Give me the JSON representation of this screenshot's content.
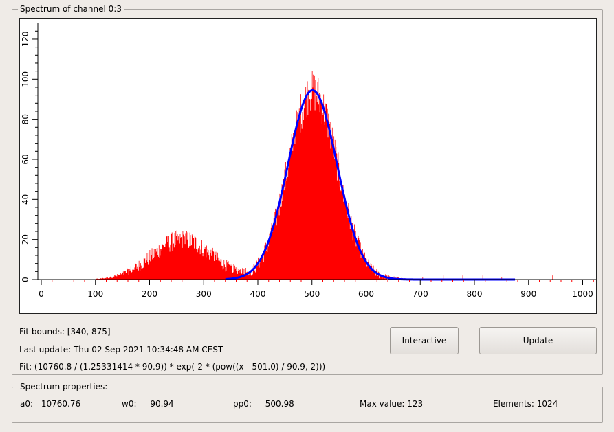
{
  "spectrum_panel": {
    "title": "Spectrum of channel 0:3",
    "fit_bounds": "Fit bounds: [340, 875]",
    "last_update": "Last update: Thu 02 Sep 2021 10:34:48 AM CEST",
    "fit_formula": "Fit: (10760.8 / (1.25331414 * 90.9)) * exp(-2 * (pow((x - 501.0) / 90.9, 2)))",
    "buttons": {
      "interactive": "Interactive",
      "update": "Update"
    }
  },
  "properties_panel": {
    "title": "Spectrum properties:",
    "a0_label": "a0:",
    "a0_value": "10760.76",
    "w0_label": "w0:",
    "w0_value": "90.94",
    "pp0_label": "pp0:",
    "pp0_value": "500.98",
    "max_value": "Max value: 123",
    "elements": "Elements: 1024"
  },
  "chart_data": {
    "type": "bar",
    "x_ticks": [
      "0",
      "100",
      "200",
      "300",
      "400",
      "500",
      "600",
      "700",
      "800",
      "900",
      "1000"
    ],
    "y_ticks": [
      "0",
      "20",
      "40",
      "60",
      "80",
      "100",
      "120"
    ],
    "xlim": [
      0,
      1024
    ],
    "ylim": [
      0,
      126
    ],
    "grid": false,
    "histogram": {
      "color": "#ff0000",
      "bin_width": 1,
      "n_bins": 1024,
      "max_value": 123,
      "peak_component": {
        "amplitude": 94,
        "center": 501,
        "width": 90.9
      },
      "shoulder_component": {
        "amplitude": 20,
        "center": 260,
        "width": 110
      },
      "lower_cutoff": 100
    },
    "fit_curve": {
      "color": "#0000ff",
      "a0": 10760.8,
      "c": 1.25331414,
      "w": 90.9,
      "center": 501.0,
      "range": [
        340,
        875
      ]
    }
  }
}
